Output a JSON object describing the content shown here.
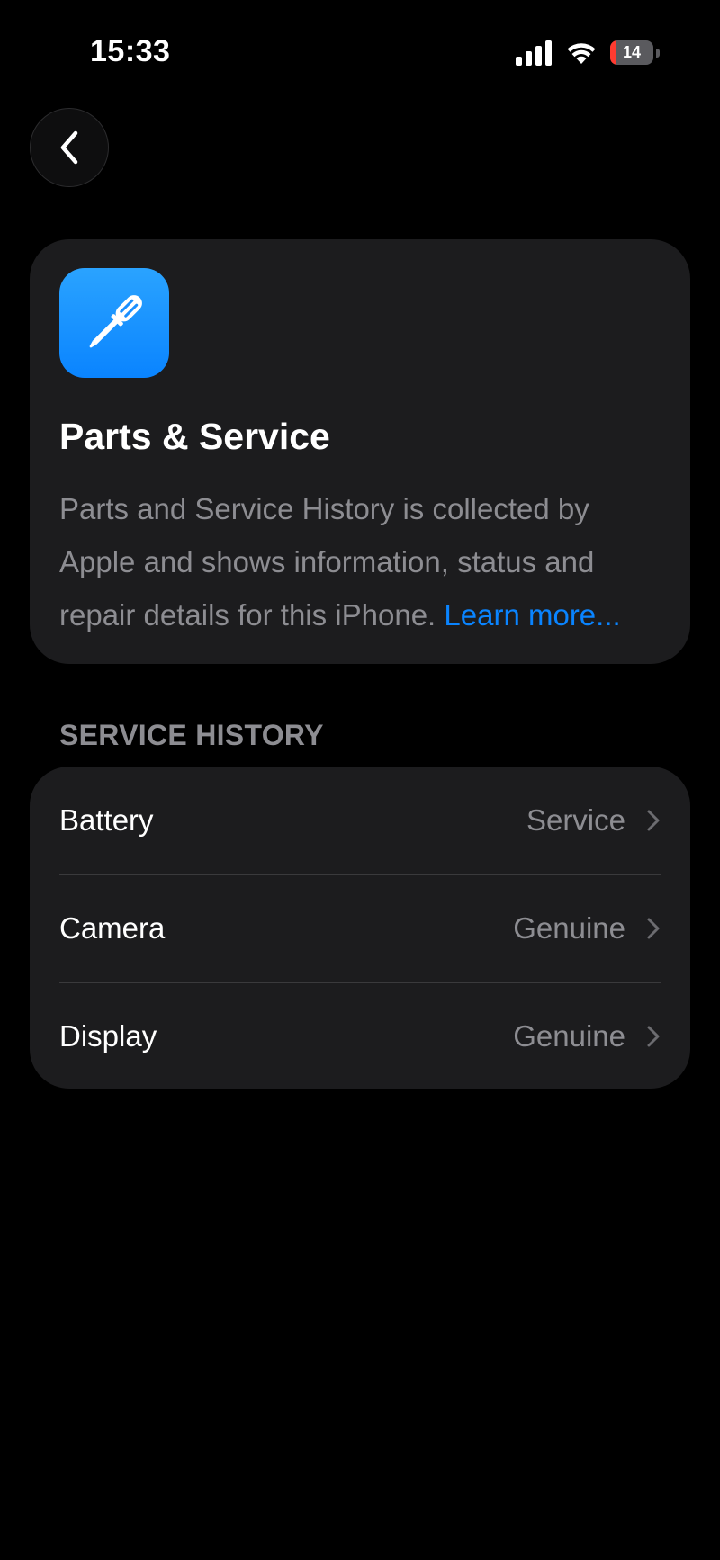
{
  "status_bar": {
    "time": "15:33",
    "battery_level": "14",
    "battery_fraction": 0.14,
    "signal_icon": "cellular-signal-icon",
    "wifi_icon": "wifi-icon",
    "battery_icon": "battery-charging-icon",
    "battery_color": "#ff3b30"
  },
  "nav": {
    "back_icon": "chevron-left-icon"
  },
  "info_card": {
    "icon": "screwdriver-icon",
    "icon_color": "#0a84ff",
    "title": "Parts & Service",
    "description": "Parts and Service History is collected by Apple and shows information, status and repair details for this iPhone.",
    "learn_more": "Learn more..."
  },
  "service_history": {
    "header": "SERVICE HISTORY",
    "rows": [
      {
        "label": "Battery",
        "value": "Service"
      },
      {
        "label": "Camera",
        "value": "Genuine"
      },
      {
        "label": "Display",
        "value": "Genuine"
      }
    ]
  },
  "colors": {
    "background": "#000000",
    "card": "#1c1c1e",
    "secondary_text": "#8d8d92",
    "accent": "#0a84ff"
  }
}
